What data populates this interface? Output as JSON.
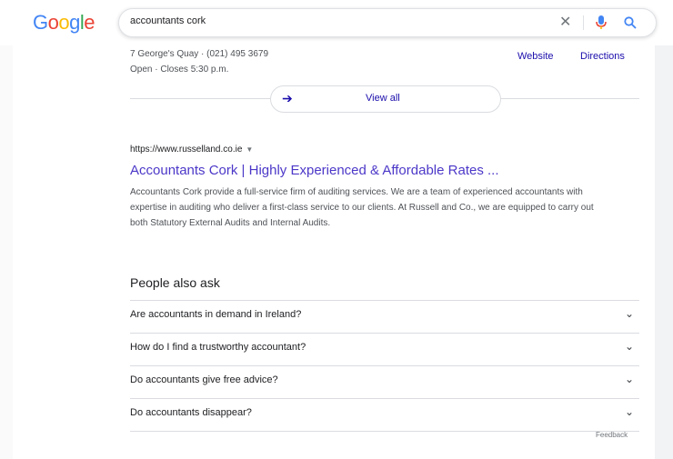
{
  "header": {
    "logo": [
      "G",
      "o",
      "o",
      "g",
      "l",
      "e"
    ],
    "logo_colors": [
      "#4285F4",
      "#EA4335",
      "#FBBC05",
      "#4285F4",
      "#34A853",
      "#EA4335"
    ],
    "search_value": "accountants cork"
  },
  "local": {
    "partial_line": "",
    "address": "7 George's Quay · (021) 495 3679",
    "hours": "Open · Closes 5:30 p.m.",
    "website_label": "Website",
    "directions_label": "Directions",
    "view_all_label": "View all"
  },
  "result": {
    "url": "https://www.russelland.co.ie",
    "title": "Accountants Cork | Highly Experienced & Affordable Rates ...",
    "snippet": "Accountants Cork provide a full-service firm of auditing services. We are a team of experienced accountants with expertise in auditing who deliver a first-class service to our clients. At Russell and Co., we are equipped to carry out both Statutory External Audits and Internal Audits."
  },
  "paa": {
    "heading": "People also ask",
    "questions": [
      "Are accountants in demand in Ireland?",
      "How do I find a trustworthy accountant?",
      "Do accountants give free advice?",
      "Do accountants disappear?"
    ],
    "feedback_label": "Feedback"
  }
}
